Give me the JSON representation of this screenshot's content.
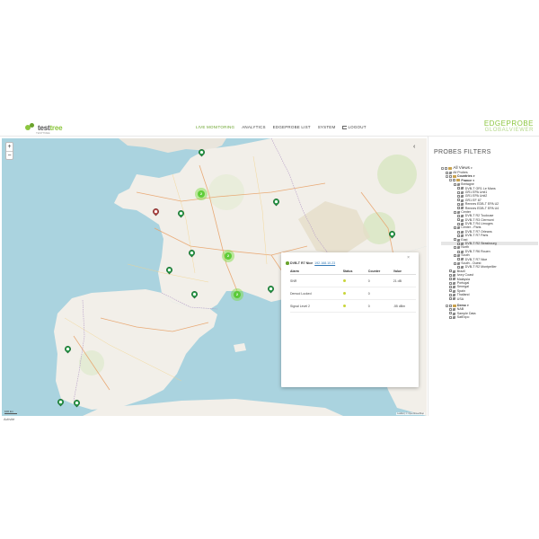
{
  "header": {
    "logo_text_left": "test",
    "logo_text_right": "tree",
    "logo_sub": "TESTTREE",
    "nav": [
      {
        "label": "LIVE MONITORING",
        "active": true
      },
      {
        "label": "ANALYTICS",
        "active": false
      },
      {
        "label": "EDGEPROBE LIST",
        "active": false
      },
      {
        "label": "SYSTEM",
        "active": false
      },
      {
        "label": "LOGOUT",
        "active": false
      }
    ],
    "brand_line1": "EDGEPROBE",
    "brand_line2": "GLOBALVIEWER"
  },
  "map": {
    "zoom_in": "+",
    "zoom_out": "−",
    "scale_label": "100 km",
    "attribution": "Leaflet | © OpenStreetMap",
    "collapse_icon": "‹",
    "clusters": [
      "2",
      "2",
      "2"
    ],
    "markers": [
      {
        "color": "#2ea44f"
      },
      {
        "color": "#2ea44f"
      },
      {
        "color": "#2ea44f"
      },
      {
        "color": "#2ea44f"
      },
      {
        "color": "#2ea44f"
      },
      {
        "color": "#2ea44f"
      },
      {
        "color": "#c0504d"
      },
      {
        "color": "#2ea44f"
      },
      {
        "color": "#2ea44f"
      },
      {
        "color": "#2ea44f"
      },
      {
        "color": "#2ea44f"
      },
      {
        "color": "#2ea44f"
      }
    ]
  },
  "popup": {
    "title": "DVB-T R7 Nice",
    "ip": "192.168.10.23",
    "close": "×",
    "columns": [
      "Alarm",
      "Status",
      "Counter",
      "Value"
    ],
    "rows": [
      {
        "alarm": "SNR",
        "counter": "0",
        "value": "21 dB"
      },
      {
        "alarm": "Demod Locked",
        "counter": "0",
        "value": ""
      },
      {
        "alarm": "Signal Level 2",
        "counter": "0",
        "value": "-55 dBm"
      }
    ]
  },
  "sidebar": {
    "title": "PROBES FILTERS",
    "tree": [
      {
        "label": "All Views",
        "level": 0,
        "kind": "folder",
        "style": "lg"
      },
      {
        "label": "All Probes",
        "level": 1,
        "kind": "tag"
      },
      {
        "label": "Countries",
        "level": 1,
        "kind": "folder",
        "style": "b"
      },
      {
        "label": "France",
        "level": 2,
        "kind": "folder",
        "style": "b"
      },
      {
        "label": "Bretagne",
        "level": 3,
        "kind": "tag"
      },
      {
        "label": "DVB-T GR1 Le Mans",
        "level": 4,
        "kind": "tag"
      },
      {
        "label": "GR1 EPA Unit1",
        "level": 4,
        "kind": "tag"
      },
      {
        "label": "GR1 EPA Unit2",
        "level": 4,
        "kind": "tag"
      },
      {
        "label": "GR1 EF 87",
        "level": 4,
        "kind": "tag"
      },
      {
        "label": "Rennes EDB-T EPA U2",
        "level": 4,
        "kind": "tag"
      },
      {
        "label": "Rennes EDB-T EPA U4",
        "level": 4,
        "kind": "tag"
      },
      {
        "label": "Center",
        "level": 3,
        "kind": "tag"
      },
      {
        "label": "DVB-T R2 Toulouse",
        "level": 4,
        "kind": "tag"
      },
      {
        "label": "DVB-T R3 Clermont",
        "level": 4,
        "kind": "tag"
      },
      {
        "label": "DVB-T R4 Limoges",
        "level": 4,
        "kind": "tag"
      },
      {
        "label": "Center - Paris",
        "level": 3,
        "kind": "tag"
      },
      {
        "label": "DVB-T R7 Orleans",
        "level": 4,
        "kind": "tag"
      },
      {
        "label": "DVB-T R7 Paris",
        "level": 4,
        "kind": "tag"
      },
      {
        "label": "East",
        "level": 3,
        "kind": "tag"
      },
      {
        "label": "DVB-T R2 Strasbourg",
        "level": 4,
        "kind": "tag",
        "selected": true
      },
      {
        "label": "North",
        "level": 3,
        "kind": "tag"
      },
      {
        "label": "DVB-T R6 Rouen",
        "level": 4,
        "kind": "tag"
      },
      {
        "label": "South",
        "level": 3,
        "kind": "tag"
      },
      {
        "label": "DVB-T R7 Nice",
        "level": 4,
        "kind": "tag"
      },
      {
        "label": "South - Ouest",
        "level": 3,
        "kind": "tag"
      },
      {
        "label": "DVB-T R2 Montpellier",
        "level": 4,
        "kind": "tag"
      },
      {
        "label": "Brazil",
        "level": 2,
        "kind": "tag"
      },
      {
        "label": "Ivory Coast",
        "level": 2,
        "kind": "tag"
      },
      {
        "label": "Malaysia",
        "level": 2,
        "kind": "tag"
      },
      {
        "label": "Portugal",
        "level": 2,
        "kind": "tag"
      },
      {
        "label": "Senegal",
        "level": 2,
        "kind": "tag"
      },
      {
        "label": "Spain",
        "level": 2,
        "kind": "tag"
      },
      {
        "label": "Thailand",
        "level": 2,
        "kind": "tag"
      },
      {
        "label": "USA",
        "level": 2,
        "kind": "tag"
      },
      {
        "label": "",
        "level": 0,
        "kind": "spacer"
      },
      {
        "label": "Demo",
        "level": 1,
        "kind": "folder",
        "style": "b"
      },
      {
        "label": "NAB",
        "level": 2,
        "kind": "tag"
      },
      {
        "label": "Sample Data",
        "level": 2,
        "kind": "tag"
      },
      {
        "label": "SatExpo",
        "level": 2,
        "kind": "tag"
      }
    ]
  },
  "status_bar": "Activité"
}
